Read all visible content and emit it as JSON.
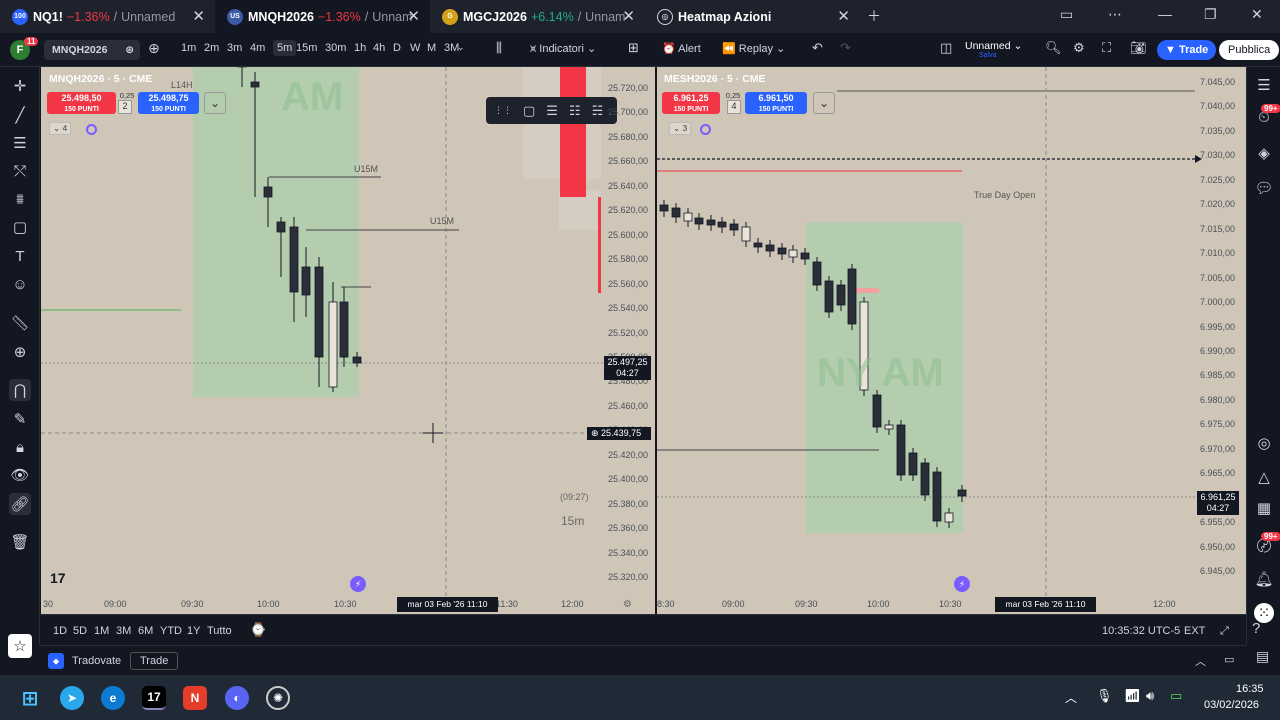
{
  "tabs": [
    {
      "icon": "100",
      "symbol": "NQ1!",
      "change": "−1.36%",
      "name": "Unnamed",
      "color": "#2962ff"
    },
    {
      "icon": "US",
      "symbol": "MNQH2026",
      "change": "−1.36%",
      "name": "Unnam",
      "color": "#2962ff"
    },
    {
      "icon": "G",
      "symbol": "MGCJ2026",
      "change": "+6.14%",
      "name": "Unnam",
      "color": "#d4a017"
    },
    {
      "icon": "◎",
      "symbol": "",
      "change": "",
      "name": "Heatmap Azioni",
      "color": "#131722"
    }
  ],
  "toolbar": {
    "avatar": "F",
    "avatar_badge": "11",
    "symbol": "MNQH2026",
    "intervals": [
      "1m",
      "2m",
      "3m",
      "4m",
      "5m",
      "15m",
      "30m",
      "1h",
      "4h",
      "D",
      "W",
      "M",
      "3M"
    ],
    "active_interval": "5m",
    "indicators": "Indicatori",
    "alert": "Alert",
    "replay": "Replay",
    "layout_name": "Unnamed",
    "layout_sub": "Salva",
    "trade": "Trade",
    "publish": "Pubblica"
  },
  "leftpane": {
    "header": "MNQH2026 · 5 · CME",
    "sell_price": "25.498,50",
    "sell_sub": "150 PUNTI",
    "spread": "0,25",
    "qty": "2",
    "buy_price": "25.498,75",
    "buy_sub": "150 PUNTI",
    "indicators_count": "4",
    "watermark": "AM",
    "labels": {
      "l14h": "L14H",
      "u15m_a": "U15M",
      "u15m_b": "U15M"
    },
    "prices": [
      "25.720,00",
      "25.700,00",
      "25.680,00",
      "25.660,00",
      "25.640,00",
      "25.620,00",
      "25.600,00",
      "25.580,00",
      "25.560,00",
      "25.540,00",
      "25.520,00",
      "25.500,00",
      "25.480,00",
      "25.460,00",
      "25.440,00",
      "25.420,00",
      "25.400,00",
      "25.380,00",
      "25.360,00",
      "25.340,00",
      "25.320,00"
    ],
    "last_price": "25.497,25",
    "last_time": "04:27",
    "cross_price": "25.439,75",
    "countdown": "(09:27)",
    "interval_label": "15m",
    "times": [
      "30",
      "09:00",
      "09:30",
      "10:00",
      "10:30",
      "11:30",
      "12:00"
    ],
    "cross_date": "mar 03 Feb '26",
    "cross_time": "11:10"
  },
  "rightpane": {
    "header": "MESH2026 · 5 · CME",
    "sell_price": "6.961,25",
    "sell_sub": "150 PUNTI",
    "spread": "0,25",
    "qty": "4",
    "buy_price": "6.961,50",
    "buy_sub": "150 PUNTI",
    "indicators_count": "3",
    "watermark": "NY AM",
    "true_day_open": "True Day Open",
    "prices": [
      "7.045,00",
      "7.040,00",
      "7.035,00",
      "7.030,00",
      "7.025,00",
      "7.020,00",
      "7.015,00",
      "7.010,00",
      "7.005,00",
      "7.000,00",
      "6.995,00",
      "6.990,00",
      "6.985,00",
      "6.980,00",
      "6.975,00",
      "6.970,00",
      "6.965,00",
      "6.960,00",
      "6.955,00",
      "6.950,00",
      "6.945,00"
    ],
    "last_price": "6.961,25",
    "last_time": "04:27",
    "times": [
      "8:30",
      "09:00",
      "09:30",
      "10:00",
      "10:30",
      "12:00"
    ],
    "cross_date": "mar 03 Feb '26",
    "cross_time": "11:10"
  },
  "bottom": {
    "ranges": [
      "1D",
      "5D",
      "1M",
      "3M",
      "6M",
      "YTD",
      "1Y",
      "Tutto"
    ],
    "clock": "10:35:32 UTC-5",
    "ext": "EXT"
  },
  "tradebar": {
    "broker": "Tradovate",
    "trade": "Trade"
  },
  "taskbar": {
    "time": "16:35",
    "date": "03/02/2026"
  },
  "rightbar_badges": [
    "99+",
    "99+"
  ],
  "colors": {
    "down": "#f23645",
    "up": "#22ab94",
    "accent": "#2962ff",
    "session": "#9fd4a6"
  }
}
